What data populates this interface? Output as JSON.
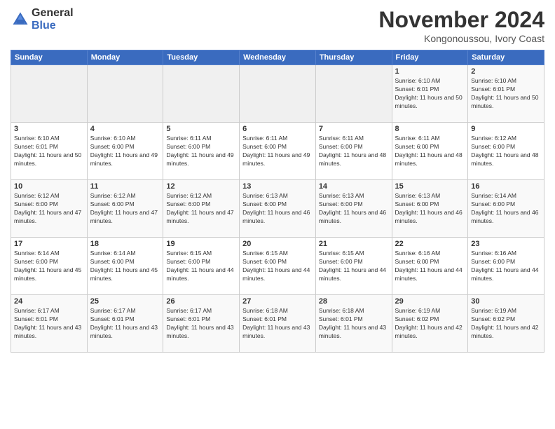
{
  "logo": {
    "general": "General",
    "blue": "Blue"
  },
  "header": {
    "month_year": "November 2024",
    "location": "Kongonoussou, Ivory Coast"
  },
  "days_of_week": [
    "Sunday",
    "Monday",
    "Tuesday",
    "Wednesday",
    "Thursday",
    "Friday",
    "Saturday"
  ],
  "weeks": [
    [
      {
        "num": "",
        "info": ""
      },
      {
        "num": "",
        "info": ""
      },
      {
        "num": "",
        "info": ""
      },
      {
        "num": "",
        "info": ""
      },
      {
        "num": "",
        "info": ""
      },
      {
        "num": "1",
        "info": "Sunrise: 6:10 AM\nSunset: 6:01 PM\nDaylight: 11 hours and 50 minutes."
      },
      {
        "num": "2",
        "info": "Sunrise: 6:10 AM\nSunset: 6:01 PM\nDaylight: 11 hours and 50 minutes."
      }
    ],
    [
      {
        "num": "3",
        "info": "Sunrise: 6:10 AM\nSunset: 6:01 PM\nDaylight: 11 hours and 50 minutes."
      },
      {
        "num": "4",
        "info": "Sunrise: 6:10 AM\nSunset: 6:00 PM\nDaylight: 11 hours and 49 minutes."
      },
      {
        "num": "5",
        "info": "Sunrise: 6:11 AM\nSunset: 6:00 PM\nDaylight: 11 hours and 49 minutes."
      },
      {
        "num": "6",
        "info": "Sunrise: 6:11 AM\nSunset: 6:00 PM\nDaylight: 11 hours and 49 minutes."
      },
      {
        "num": "7",
        "info": "Sunrise: 6:11 AM\nSunset: 6:00 PM\nDaylight: 11 hours and 48 minutes."
      },
      {
        "num": "8",
        "info": "Sunrise: 6:11 AM\nSunset: 6:00 PM\nDaylight: 11 hours and 48 minutes."
      },
      {
        "num": "9",
        "info": "Sunrise: 6:12 AM\nSunset: 6:00 PM\nDaylight: 11 hours and 48 minutes."
      }
    ],
    [
      {
        "num": "10",
        "info": "Sunrise: 6:12 AM\nSunset: 6:00 PM\nDaylight: 11 hours and 47 minutes."
      },
      {
        "num": "11",
        "info": "Sunrise: 6:12 AM\nSunset: 6:00 PM\nDaylight: 11 hours and 47 minutes."
      },
      {
        "num": "12",
        "info": "Sunrise: 6:12 AM\nSunset: 6:00 PM\nDaylight: 11 hours and 47 minutes."
      },
      {
        "num": "13",
        "info": "Sunrise: 6:13 AM\nSunset: 6:00 PM\nDaylight: 11 hours and 46 minutes."
      },
      {
        "num": "14",
        "info": "Sunrise: 6:13 AM\nSunset: 6:00 PM\nDaylight: 11 hours and 46 minutes."
      },
      {
        "num": "15",
        "info": "Sunrise: 6:13 AM\nSunset: 6:00 PM\nDaylight: 11 hours and 46 minutes."
      },
      {
        "num": "16",
        "info": "Sunrise: 6:14 AM\nSunset: 6:00 PM\nDaylight: 11 hours and 46 minutes."
      }
    ],
    [
      {
        "num": "17",
        "info": "Sunrise: 6:14 AM\nSunset: 6:00 PM\nDaylight: 11 hours and 45 minutes."
      },
      {
        "num": "18",
        "info": "Sunrise: 6:14 AM\nSunset: 6:00 PM\nDaylight: 11 hours and 45 minutes."
      },
      {
        "num": "19",
        "info": "Sunrise: 6:15 AM\nSunset: 6:00 PM\nDaylight: 11 hours and 44 minutes."
      },
      {
        "num": "20",
        "info": "Sunrise: 6:15 AM\nSunset: 6:00 PM\nDaylight: 11 hours and 44 minutes."
      },
      {
        "num": "21",
        "info": "Sunrise: 6:15 AM\nSunset: 6:00 PM\nDaylight: 11 hours and 44 minutes."
      },
      {
        "num": "22",
        "info": "Sunrise: 6:16 AM\nSunset: 6:00 PM\nDaylight: 11 hours and 44 minutes."
      },
      {
        "num": "23",
        "info": "Sunrise: 6:16 AM\nSunset: 6:00 PM\nDaylight: 11 hours and 44 minutes."
      }
    ],
    [
      {
        "num": "24",
        "info": "Sunrise: 6:17 AM\nSunset: 6:01 PM\nDaylight: 11 hours and 43 minutes."
      },
      {
        "num": "25",
        "info": "Sunrise: 6:17 AM\nSunset: 6:01 PM\nDaylight: 11 hours and 43 minutes."
      },
      {
        "num": "26",
        "info": "Sunrise: 6:17 AM\nSunset: 6:01 PM\nDaylight: 11 hours and 43 minutes."
      },
      {
        "num": "27",
        "info": "Sunrise: 6:18 AM\nSunset: 6:01 PM\nDaylight: 11 hours and 43 minutes."
      },
      {
        "num": "28",
        "info": "Sunrise: 6:18 AM\nSunset: 6:01 PM\nDaylight: 11 hours and 43 minutes."
      },
      {
        "num": "29",
        "info": "Sunrise: 6:19 AM\nSunset: 6:02 PM\nDaylight: 11 hours and 42 minutes."
      },
      {
        "num": "30",
        "info": "Sunrise: 6:19 AM\nSunset: 6:02 PM\nDaylight: 11 hours and 42 minutes."
      }
    ]
  ]
}
